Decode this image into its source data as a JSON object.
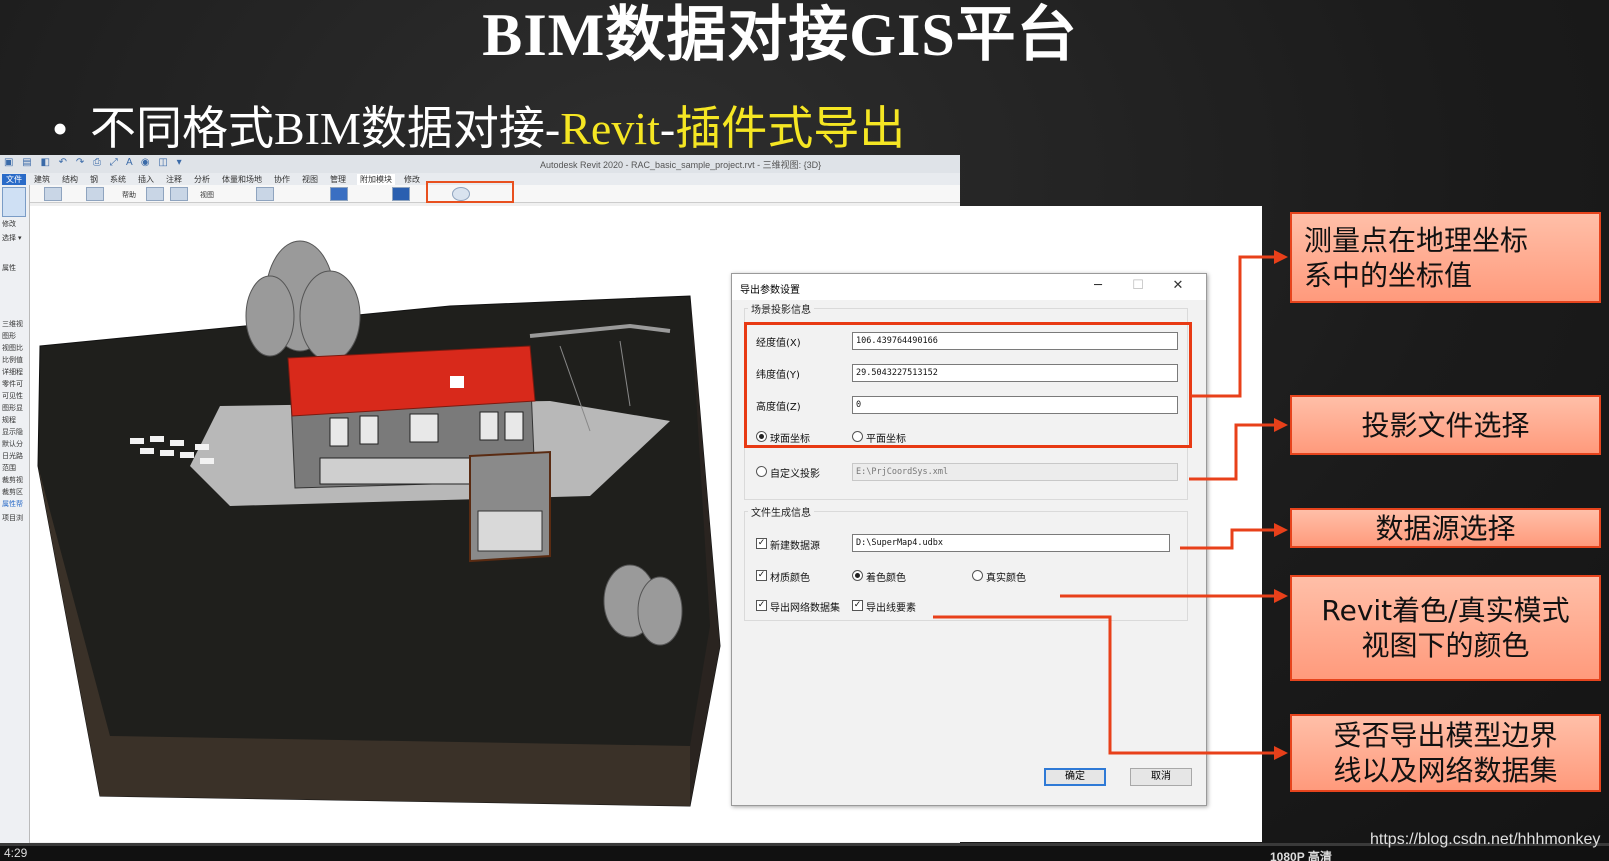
{
  "slide": {
    "title": "BIM数据对接GIS平台",
    "bullet_prefix": "不同格式BIM数据对接-",
    "bullet_revit": "Revit",
    "bullet_dash": "-",
    "bullet_highlight": "插件式导出"
  },
  "revit": {
    "window_title": "Autodesk Revit 2020 - RAC_basic_sample_project.rvt - 三维视图: {3D}",
    "tabs": [
      "文件",
      "建筑",
      "结构",
      "钢",
      "系统",
      "插入",
      "注释",
      "分析",
      "体量和场地",
      "协作",
      "视图",
      "管理",
      "附加模块",
      "修改"
    ],
    "ribbon_labels": [
      "帮助",
      "视图"
    ],
    "left_panel": [
      "修改",
      "选择 ▾",
      "属性",
      "三维视",
      "图形",
      "视图比",
      "比例值",
      "详细程",
      "零件可",
      "可见性",
      "图形显",
      "规程",
      "显示隐",
      "默认分",
      "日光路",
      "范围",
      "裁剪视",
      "裁剪区",
      "属性帮",
      "项目浏"
    ]
  },
  "dialog": {
    "title": "导出参数设置",
    "scene_group_title": "场景投影信息",
    "longitude_label": "经度值(X)",
    "longitude_value": "106.439764490166",
    "latitude_label": "纬度值(Y)",
    "latitude_value": "29.5043227513152",
    "height_label": "高度值(Z)",
    "height_value": "0",
    "sphere_coord_label": "球面坐标",
    "plane_coord_label": "平面坐标",
    "custom_proj_label": "自定义投影",
    "custom_proj_value": "E:\\PrjCoordSys.xml",
    "file_group_title": "文件生成信息",
    "new_datasource_label": "新建数据源",
    "datasource_value": "D:\\SuperMap4.udbx",
    "material_color_label": "材质颜色",
    "shading_color_label": "着色颜色",
    "real_color_label": "真实颜色",
    "export_network_label": "导出网络数据集",
    "export_lines_label": "导出线要素",
    "ok_label": "确定",
    "cancel_label": "取消"
  },
  "callouts": {
    "c1_line1": "测量点在地理坐标",
    "c1_line2": "系中的坐标值",
    "c2": "投影文件选择",
    "c3": "数据源选择",
    "c4_line1": "Revit着色/真实模式",
    "c4_line2": "视图下的颜色",
    "c5_line1": "受否导出模型边界",
    "c5_line2": "线以及网络数据集"
  },
  "player": {
    "time": "4:29",
    "quality": "1080P 高清",
    "watermark": "https://blog.csdn.net/hhhmonkey"
  },
  "colors": {
    "callout_border": "#e6441d",
    "highlight_yellow": "#f5e623",
    "roof_red": "#d8291b"
  }
}
